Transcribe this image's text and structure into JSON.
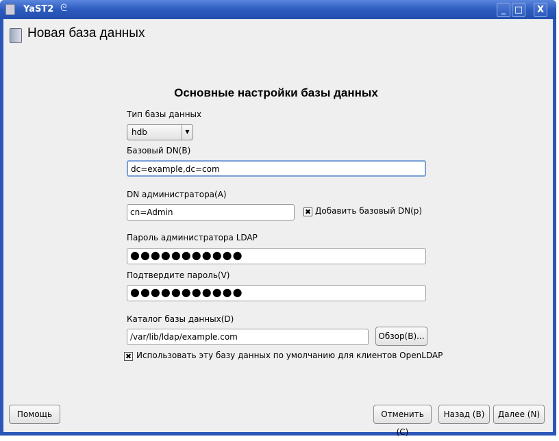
{
  "window": {
    "title": "YaST2",
    "controls": {
      "minimize": "_",
      "maximize": "□",
      "close": "X"
    }
  },
  "header": {
    "title": "Новая база данных"
  },
  "form": {
    "heading": "Основные настройки базы данных",
    "db_type": {
      "label": "Тип базы данных",
      "value": "hdb"
    },
    "base_dn": {
      "label": "Базовый DN(B)",
      "value": "dc=example,dc=com"
    },
    "admin_dn": {
      "label": "DN администратора(A)",
      "value": "cn=Admin"
    },
    "append_base_dn": {
      "label": "Добавить базовый DN(p)",
      "checked": true
    },
    "password": {
      "label": "Пароль администратора LDAP",
      "value": "●●●●●●●●●●●"
    },
    "confirm_password": {
      "label": "Подтвердите пароль(V)",
      "value": "●●●●●●●●●●●"
    },
    "db_dir": {
      "label": "Каталог базы данных(D)",
      "value": "/var/lib/ldap/example.com"
    },
    "browse": "Обзор(B)...",
    "use_default": {
      "label": "Использовать эту базу данных по умолчанию для клиентов OpenLDAP",
      "checked": true
    }
  },
  "buttons": {
    "help": "Помощь",
    "cancel": "Отменить (C)",
    "back": "Назад (B)",
    "next": "Далее (N)"
  },
  "check_mark": "✖"
}
